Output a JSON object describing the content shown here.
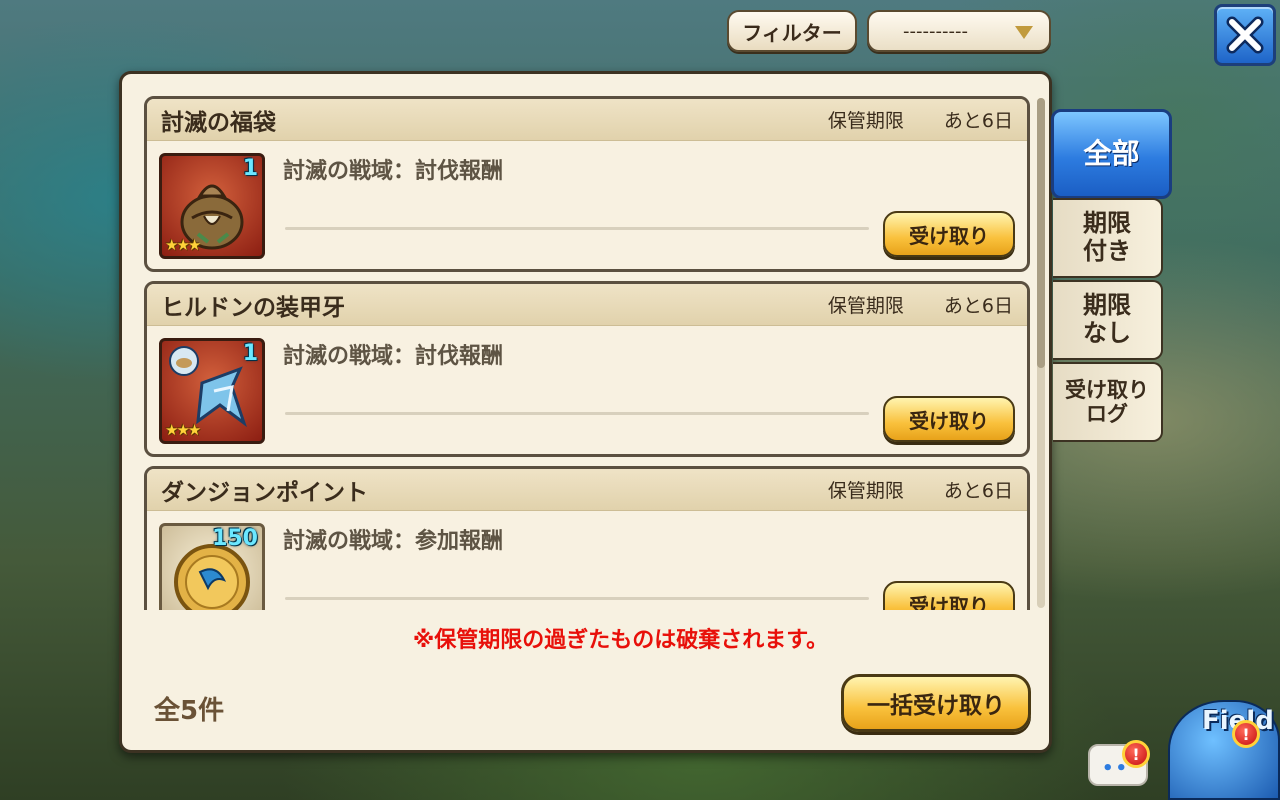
{
  "toolbar": {
    "filter_label": "フィルター",
    "filter_value": "----------"
  },
  "items": [
    {
      "title": "討滅の福袋",
      "expiry_label": "保管期限",
      "expiry_value": "あと6日",
      "source": "討滅の戦域：討伐報酬",
      "quantity": "1",
      "stars": "★★★",
      "icon": "treasure-bag-icon",
      "button": "受け取り"
    },
    {
      "title": "ヒルドンの装甲牙",
      "expiry_label": "保管期限",
      "expiry_value": "あと6日",
      "source": "討滅の戦域：討伐報酬",
      "quantity": "1",
      "stars": "★★★",
      "icon": "armored-fang-icon",
      "button": "受け取り"
    },
    {
      "title": "ダンジョンポイント",
      "expiry_label": "保管期限",
      "expiry_value": "あと6日",
      "source": "討滅の戦域：参加報酬",
      "quantity": "150",
      "stars": "",
      "icon": "dungeon-point-coin-icon",
      "button": "受け取り"
    }
  ],
  "notice": "※保管期限の過ぎたものは破棄されます。",
  "total_count": "全5件",
  "bulk_button": "一括受け取り",
  "tabs": [
    {
      "label": "全部",
      "active": true
    },
    {
      "label": "期限\n付き",
      "active": false
    },
    {
      "label": "期限\nなし",
      "active": false
    },
    {
      "label": "受け取り\nログ",
      "active": false
    }
  ],
  "field_button": "Field",
  "colors": {
    "accent_blue": "#2d7ce0",
    "button_gold": "#f9c13c",
    "notice_red": "#e8100a",
    "panel_bg": "#f7f1e1"
  }
}
